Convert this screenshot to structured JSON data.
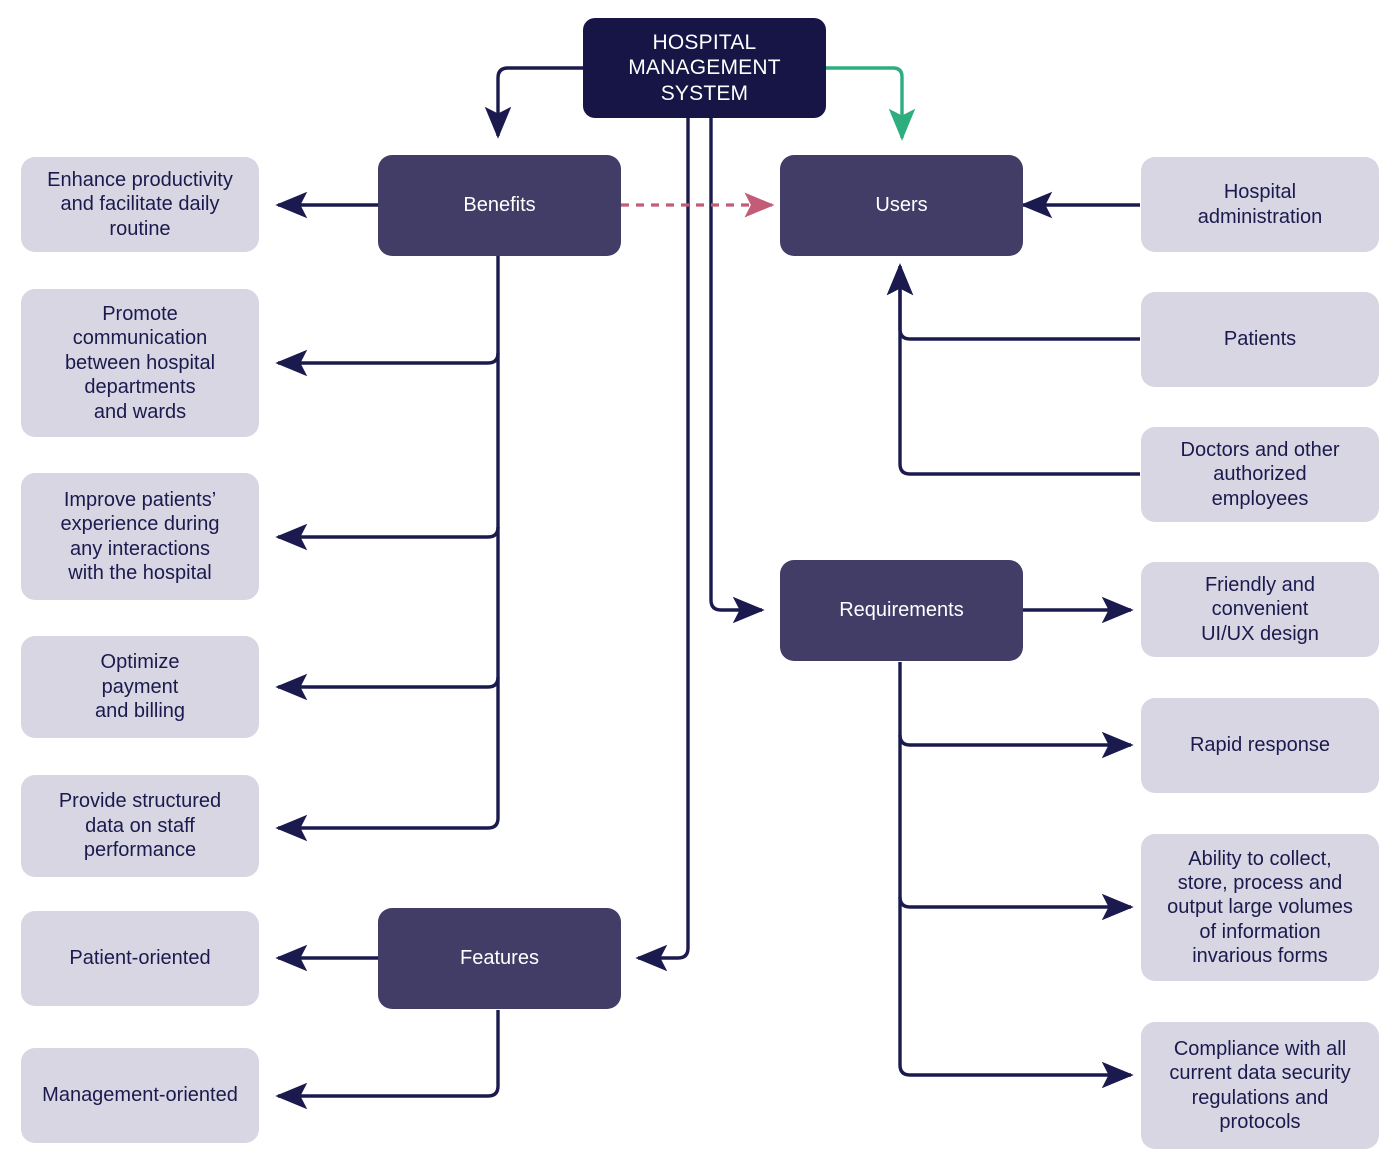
{
  "diagram": {
    "title": "Hospital Management System",
    "type": "flowchart",
    "colors": {
      "root_fill": "#161545",
      "primary_fill": "#413d67",
      "leaf_fill": "#d7d6e2",
      "leaf_text": "#1b1a4e",
      "edge": "#1b1a4e",
      "edge_accent_green": "#2eae7f",
      "edge_accent_red": "#c25c77",
      "background": "#ffffff"
    },
    "nodes": {
      "root": {
        "label": "HOSPITAL\nMANAGEMENT\nSYSTEM"
      },
      "benefits": {
        "label": "Benefits"
      },
      "users": {
        "label": "Users"
      },
      "requirements": {
        "label": "Requirements"
      },
      "features": {
        "label": "Features"
      }
    },
    "benefits_items": [
      {
        "label": "Enhance productivity\nand facilitate daily\nroutine"
      },
      {
        "label": "Promote\ncommunication\nbetween hospital\ndepartments\nand wards"
      },
      {
        "label": "Improve patients’\nexperience during\nany interactions\nwith the hospital"
      },
      {
        "label": "Optimize\npayment\nand billing"
      },
      {
        "label": "Provide structured\ndata on staff\nperformance"
      }
    ],
    "features_items": [
      {
        "label": "Patient-oriented"
      },
      {
        "label": "Management-oriented"
      }
    ],
    "users_items": [
      {
        "label": "Hospital\nadministration"
      },
      {
        "label": "Patients"
      },
      {
        "label": "Doctors and other\nauthorized\nemployees"
      }
    ],
    "requirements_items": [
      {
        "label": "Friendly and\nconvenient\nUI/UX design"
      },
      {
        "label": "Rapid response"
      },
      {
        "label": "Ability to collect,\nstore, process and\noutput large volumes\nof information\ninvarious forms"
      },
      {
        "label": "Compliance with all\ncurrent data security\nregulations and\nprotocols"
      }
    ]
  }
}
